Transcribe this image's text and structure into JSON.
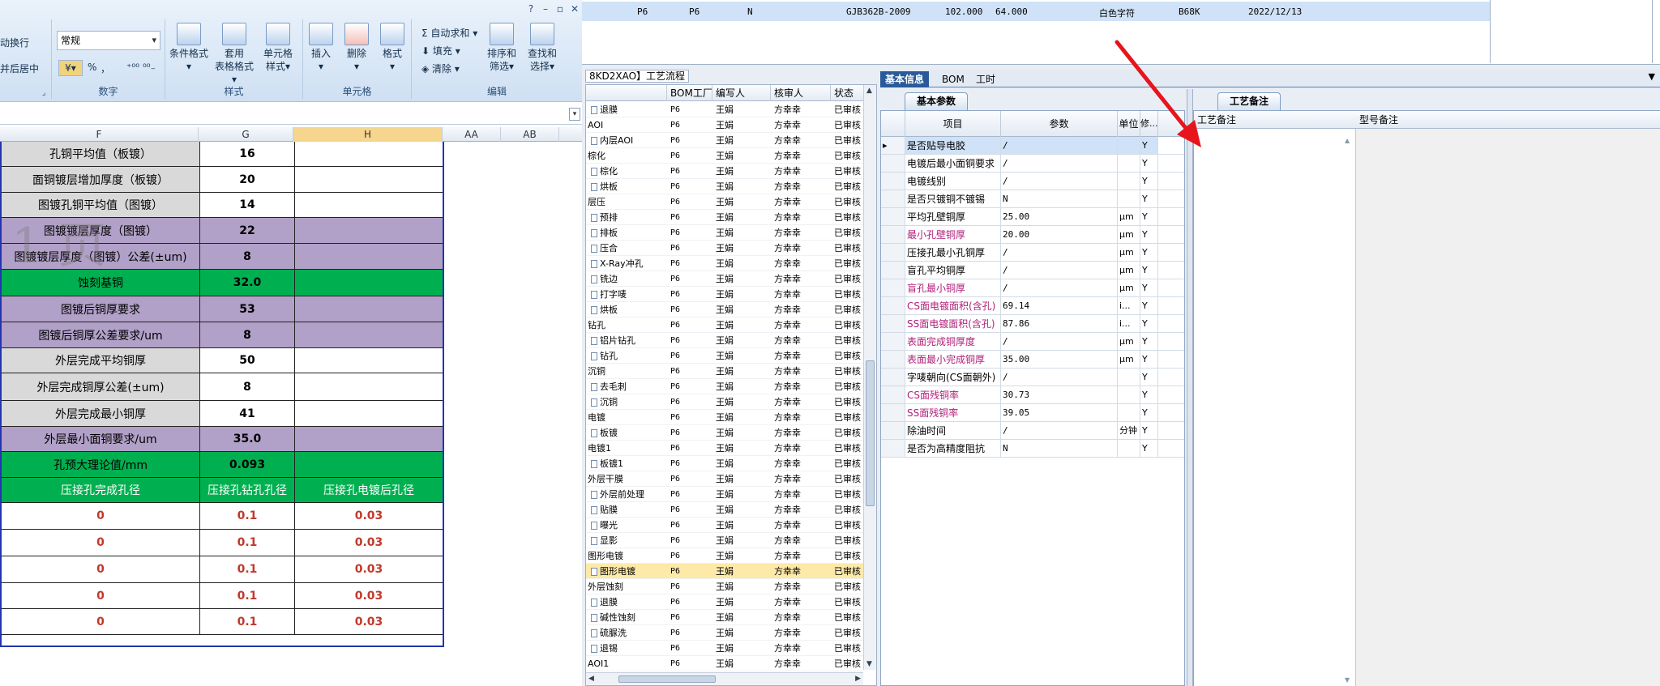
{
  "excel": {
    "ribbon": {
      "wrap_text": "动换行",
      "merge_center": "并后居中",
      "number_format": "常规",
      "percent": "%",
      "comma": "，",
      "inc_decimal": "⁺⁰⁰",
      "dec_decimal": "⁰⁰₋",
      "groups": {
        "number": "数字",
        "styles": "样式",
        "cells": "单元格",
        "editing": "编辑"
      },
      "styles_buttons": [
        {
          "label": "条件格式",
          "sub": "▾"
        },
        {
          "label": "套用",
          "sub": "表格格式▾"
        },
        {
          "label": "单元格",
          "sub": "样式▾"
        }
      ],
      "cells_buttons": [
        {
          "label": "插入",
          "sub": "▾"
        },
        {
          "label": "删除",
          "sub": "▾"
        },
        {
          "label": "格式",
          "sub": "▾"
        }
      ],
      "autosum": "自动求和",
      "fill": "填充",
      "clear": "清除",
      "sort_filter": {
        "label": "排序和",
        "sub": "筛选▾"
      },
      "find_select": {
        "label": "查找和",
        "sub": "选择▾"
      },
      "help": "?",
      "minimize": "–",
      "restore": "▫",
      "close": "✕"
    },
    "columns": [
      "F",
      "G",
      "H",
      "AA",
      "AB"
    ],
    "watermark": "1 页",
    "rows": [
      {
        "label": "孔铜平均值（板镀）",
        "g": "16",
        "h": "",
        "fill": "gray",
        "style": "bold"
      },
      {
        "label": "面铜镀层增加厚度（板镀）",
        "g": "20",
        "h": "",
        "fill": "gray",
        "style": "bold"
      },
      {
        "label": "图镀孔铜平均值（图镀）",
        "g": "14",
        "h": "",
        "fill": "gray",
        "style": "bold"
      },
      {
        "label": "图镀镀层厚度（图镀）",
        "g": "22",
        "h": "",
        "fill": "purple",
        "style": "bold"
      },
      {
        "label": "图镀镀层厚度（图镀）公差(±um)",
        "g": "8",
        "h": "",
        "fill": "purple",
        "style": "bold"
      },
      {
        "label": "蚀刻基铜",
        "g": "32.0",
        "h": "",
        "fill": "green",
        "style": "bold"
      },
      {
        "label": "图镀后铜厚要求",
        "g": "53",
        "h": "",
        "fill": "purple",
        "style": "bold"
      },
      {
        "label": "图镀后铜厚公差要求/um",
        "g": "8",
        "h": "",
        "fill": "purple",
        "style": "bold"
      },
      {
        "label": "外层完成平均铜厚",
        "g": "50",
        "h": "",
        "fill": "gray",
        "style": "bold"
      },
      {
        "label": "外层完成铜厚公差(±um)",
        "g": "8",
        "h": "",
        "fill": "gray",
        "style": "bold"
      },
      {
        "label": "外层完成最小铜厚",
        "g": "41",
        "h": "",
        "fill": "gray",
        "style": "bold"
      },
      {
        "label": "外层最小面铜要求/um",
        "g": "35.0",
        "h": "",
        "fill": "purple",
        "style": "bold"
      },
      {
        "label": "孔预大理论值/mm",
        "g": "0.093",
        "h": "",
        "fill": "green",
        "style": "bold"
      },
      {
        "label": "压接孔完成孔径",
        "g": "压接孔钻孔孔径",
        "h": "压接孔电镀后孔径",
        "fill": "green",
        "style": "header"
      },
      {
        "label": "0",
        "g": "0.1",
        "h": "0.03",
        "fill": "white",
        "style": "red"
      },
      {
        "label": "0",
        "g": "0.1",
        "h": "0.03",
        "fill": "white",
        "style": "red"
      },
      {
        "label": "0",
        "g": "0.1",
        "h": "0.03",
        "fill": "white",
        "style": "red"
      },
      {
        "label": "0",
        "g": "0.1",
        "h": "0.03",
        "fill": "white",
        "style": "red"
      },
      {
        "label": "0",
        "g": "0.1",
        "h": "0.03",
        "fill": "white",
        "style": "red"
      }
    ]
  },
  "app": {
    "top_row": {
      "c1": "P6",
      "c2": "P6",
      "c3": "N",
      "c4": "GJB362B-2009",
      "c5": "102.000",
      "c6": "64.000",
      "c7": "白色字符",
      "c8": "B68K",
      "c9": "2022/12/13"
    },
    "flow_title": "8KD2XAO】工艺流程",
    "flow_headers": [
      "",
      "BOM工厂",
      "编写人",
      "核审人",
      "状态"
    ],
    "flow_rows": [
      {
        "name": "退膜",
        "child": true,
        "bom": "P6",
        "w": "王娟",
        "r": "方幸幸",
        "s": "已审核"
      },
      {
        "name": "AOI",
        "child": false,
        "bom": "P6",
        "w": "王娟",
        "r": "方幸幸",
        "s": "已审核"
      },
      {
        "name": "内层AOI",
        "child": true,
        "bom": "P6",
        "w": "王娟",
        "r": "方幸幸",
        "s": "已审核"
      },
      {
        "name": "棕化",
        "child": false,
        "bom": "P6",
        "w": "王娟",
        "r": "方幸幸",
        "s": "已审核"
      },
      {
        "name": "棕化",
        "child": true,
        "bom": "P6",
        "w": "王娟",
        "r": "方幸幸",
        "s": "已审核"
      },
      {
        "name": "烘板",
        "child": true,
        "bom": "P6",
        "w": "王娟",
        "r": "方幸幸",
        "s": "已审核"
      },
      {
        "name": "层压",
        "child": false,
        "bom": "P6",
        "w": "王娟",
        "r": "方幸幸",
        "s": "已审核"
      },
      {
        "name": "预排",
        "child": true,
        "bom": "P6",
        "w": "王娟",
        "r": "方幸幸",
        "s": "已审核"
      },
      {
        "name": "排板",
        "child": true,
        "bom": "P6",
        "w": "王娟",
        "r": "方幸幸",
        "s": "已审核"
      },
      {
        "name": "压合",
        "child": true,
        "bom": "P6",
        "w": "王娟",
        "r": "方幸幸",
        "s": "已审核"
      },
      {
        "name": "X-Ray冲孔",
        "child": true,
        "bom": "P6",
        "w": "王娟",
        "r": "方幸幸",
        "s": "已审核"
      },
      {
        "name": "铣边",
        "child": true,
        "bom": "P6",
        "w": "王娟",
        "r": "方幸幸",
        "s": "已审核"
      },
      {
        "name": "打字唛",
        "child": true,
        "bom": "P6",
        "w": "王娟",
        "r": "方幸幸",
        "s": "已审核"
      },
      {
        "name": "烘板",
        "child": true,
        "bom": "P6",
        "w": "王娟",
        "r": "方幸幸",
        "s": "已审核"
      },
      {
        "name": "钻孔",
        "child": false,
        "bom": "P6",
        "w": "王娟",
        "r": "方幸幸",
        "s": "已审核"
      },
      {
        "name": "铝片钻孔",
        "child": true,
        "bom": "P6",
        "w": "王娟",
        "r": "方幸幸",
        "s": "已审核"
      },
      {
        "name": "钻孔",
        "child": true,
        "bom": "P6",
        "w": "王娟",
        "r": "方幸幸",
        "s": "已审核"
      },
      {
        "name": "沉铜",
        "child": false,
        "bom": "P6",
        "w": "王娟",
        "r": "方幸幸",
        "s": "已审核"
      },
      {
        "name": "去毛刺",
        "child": true,
        "bom": "P6",
        "w": "王娟",
        "r": "方幸幸",
        "s": "已审核"
      },
      {
        "name": "沉铜",
        "child": true,
        "bom": "P6",
        "w": "王娟",
        "r": "方幸幸",
        "s": "已审核"
      },
      {
        "name": "电镀",
        "child": false,
        "bom": "P6",
        "w": "王娟",
        "r": "方幸幸",
        "s": "已审核"
      },
      {
        "name": "板镀",
        "child": true,
        "bom": "P6",
        "w": "王娟",
        "r": "方幸幸",
        "s": "已审核"
      },
      {
        "name": "电镀1",
        "child": false,
        "bom": "P6",
        "w": "王娟",
        "r": "方幸幸",
        "s": "已审核"
      },
      {
        "name": "板镀1",
        "child": true,
        "bom": "P6",
        "w": "王娟",
        "r": "方幸幸",
        "s": "已审核"
      },
      {
        "name": "外层干膜",
        "child": false,
        "bom": "P6",
        "w": "王娟",
        "r": "方幸幸",
        "s": "已审核"
      },
      {
        "name": "外层前处理",
        "child": true,
        "bom": "P6",
        "w": "王娟",
        "r": "方幸幸",
        "s": "已审核"
      },
      {
        "name": "贴膜",
        "child": true,
        "bom": "P6",
        "w": "王娟",
        "r": "方幸幸",
        "s": "已审核"
      },
      {
        "name": "曝光",
        "child": true,
        "bom": "P6",
        "w": "王娟",
        "r": "方幸幸",
        "s": "已审核"
      },
      {
        "name": "显影",
        "child": true,
        "bom": "P6",
        "w": "王娟",
        "r": "方幸幸",
        "s": "已审核"
      },
      {
        "name": "图形电镀",
        "child": false,
        "bom": "P6",
        "w": "王娟",
        "r": "方幸幸",
        "s": "已审核"
      },
      {
        "name": "图形电镀",
        "child": true,
        "bom": "P6",
        "w": "王娟",
        "r": "方幸幸",
        "s": "已审核",
        "selected": true
      },
      {
        "name": "外层蚀刻",
        "child": false,
        "bom": "P6",
        "w": "王娟",
        "r": "方幸幸",
        "s": "已审核"
      },
      {
        "name": "退膜",
        "child": true,
        "bom": "P6",
        "w": "王娟",
        "r": "方幸幸",
        "s": "已审核"
      },
      {
        "name": "碱性蚀刻",
        "child": true,
        "bom": "P6",
        "w": "王娟",
        "r": "方幸幸",
        "s": "已审核"
      },
      {
        "name": "硫脲洗",
        "child": true,
        "bom": "P6",
        "w": "王娟",
        "r": "方幸幸",
        "s": "已审核"
      },
      {
        "name": "退锡",
        "child": true,
        "bom": "P6",
        "w": "王娟",
        "r": "方幸幸",
        "s": "已审核"
      },
      {
        "name": "AOI1",
        "child": false,
        "bom": "P6",
        "w": "王娟",
        "r": "方幸幸",
        "s": "已审核"
      }
    ],
    "detail_tabs": [
      "基本信息",
      "BOM",
      "工时"
    ],
    "param_tab": "基本参数",
    "remark_tab": "工艺备注",
    "param_headers": [
      "",
      "项目",
      "参数",
      "单位",
      "修..."
    ],
    "params": [
      {
        "name": "是否贴导电胶",
        "val": "/",
        "unit": "",
        "y": "Y",
        "mag": false,
        "sel": true
      },
      {
        "name": "电镀后最小面铜要求",
        "val": "/",
        "unit": "",
        "y": "Y",
        "mag": false
      },
      {
        "name": "电镀线别",
        "val": "/",
        "unit": "",
        "y": "Y",
        "mag": false
      },
      {
        "name": "是否只镀铜不镀锡",
        "val": "N",
        "unit": "",
        "y": "Y",
        "mag": false
      },
      {
        "name": "平均孔壁铜厚",
        "val": "25.00",
        "unit": "μm",
        "y": "Y",
        "mag": false
      },
      {
        "name": "最小孔壁铜厚",
        "val": "20.00",
        "unit": "μm",
        "y": "Y",
        "mag": true
      },
      {
        "name": "压接孔最小孔铜厚",
        "val": "/",
        "unit": "μm",
        "y": "Y",
        "mag": false
      },
      {
        "name": "盲孔平均铜厚",
        "val": "/",
        "unit": "μm",
        "y": "Y",
        "mag": false
      },
      {
        "name": "盲孔最小铜厚",
        "val": "/",
        "unit": "μm",
        "y": "Y",
        "mag": true
      },
      {
        "name": "CS面电镀面积(含孔)",
        "val": "69.14",
        "unit": "i...",
        "y": "Y",
        "mag": true
      },
      {
        "name": "SS面电镀面积(含孔)",
        "val": "87.86",
        "unit": "i...",
        "y": "Y",
        "mag": true
      },
      {
        "name": "表面完成铜厚度",
        "val": "/",
        "unit": "μm",
        "y": "Y",
        "mag": true
      },
      {
        "name": "表面最小完成铜厚",
        "val": "35.00",
        "unit": "μm",
        "y": "Y",
        "mag": true
      },
      {
        "name": "字唛朝向(CS面朝外)",
        "val": "/",
        "unit": "",
        "y": "Y",
        "mag": false
      },
      {
        "name": "CS面残铜率",
        "val": "30.73",
        "unit": "",
        "y": "Y",
        "mag": true
      },
      {
        "name": "SS面残铜率",
        "val": "39.05",
        "unit": "",
        "y": "Y",
        "mag": true
      },
      {
        "name": "除油时间",
        "val": "/",
        "unit": "分钟",
        "y": "Y",
        "mag": false
      },
      {
        "name": "是否为高精度阻抗",
        "val": "N",
        "unit": "",
        "y": "Y",
        "mag": false
      }
    ],
    "remark_headers": [
      "工艺备注",
      "型号备注"
    ],
    "colors": {
      "accent": "#2a5a9a",
      "selected_row": "#fde9a8",
      "magenta": "#b0207a",
      "arrow": "#e8141c"
    }
  }
}
